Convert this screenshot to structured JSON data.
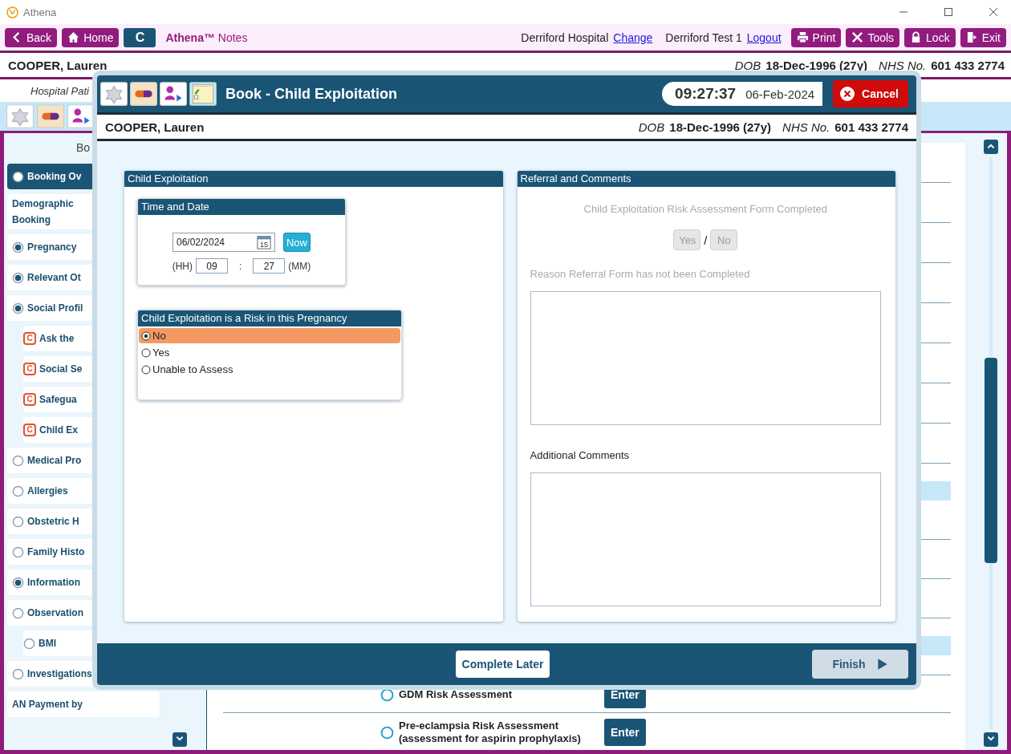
{
  "window": {
    "title": "Athena"
  },
  "toolbar": {
    "nav_buttons": [
      {
        "label": "Back"
      },
      {
        "label": "Home"
      }
    ],
    "c_button": "C",
    "app_name": "**Athena™** Notes",
    "hospital": "Derriford Hospital",
    "hospital_link": "Change",
    "user": "Derriford Test 1",
    "user_link": "Logout",
    "actions": [
      {
        "label": "Print"
      },
      {
        "label": "Tools"
      },
      {
        "label": "Lock"
      },
      {
        "label": "Exit"
      }
    ]
  },
  "patient": {
    "name": "COOPER, Lauren",
    "dob_label": "DOB",
    "dob": "18-Dec-1996 (27y)",
    "nhs_label": "NHS No.",
    "nhs": "601 433 2774"
  },
  "subheader": "Hospital Pati",
  "sidebar": {
    "heading": "Bo",
    "items": [
      {
        "label": "Booking Ov",
        "kind": "radio",
        "checked": false,
        "selected": true
      },
      {
        "label": "Demographic\nBooking",
        "kind": "plain",
        "selected": false
      },
      {
        "label": "Pregnancy",
        "kind": "radio",
        "checked": true,
        "selected": false
      },
      {
        "label": "Relevant Ot",
        "kind": "radio",
        "checked": true,
        "selected": false
      },
      {
        "label": "Social Profil",
        "kind": "radio",
        "checked": true,
        "selected": false,
        "children": [
          {
            "label": "Ask the",
            "kind": "badge",
            "badge": "C",
            "selected": false
          },
          {
            "label": "Social Se",
            "kind": "badge",
            "badge": "C",
            "selected": false
          },
          {
            "label": "Safegua",
            "kind": "badge",
            "badge": "C",
            "selected": false
          },
          {
            "label": "Child Ex",
            "kind": "badge",
            "badge": "C",
            "selected": false
          }
        ]
      },
      {
        "label": "Medical Pro",
        "kind": "radio",
        "checked": false,
        "selected": false
      },
      {
        "label": "Allergies",
        "kind": "radio",
        "checked": false,
        "selected": false
      },
      {
        "label": "Obstetric H",
        "kind": "radio",
        "checked": false,
        "selected": false
      },
      {
        "label": "Family Histo",
        "kind": "radio",
        "checked": false,
        "selected": false
      },
      {
        "label": "Information",
        "kind": "radio",
        "checked": true,
        "selected": false
      },
      {
        "label": "Observation",
        "kind": "radio",
        "checked": false,
        "selected": false,
        "children": [
          {
            "label": "BMI",
            "kind": "radio",
            "checked": false,
            "selected": false
          }
        ]
      },
      {
        "label": "Investigations",
        "kind": "radio",
        "checked": false,
        "selected": false
      },
      {
        "label": "AN Payment by",
        "kind": "plain",
        "selected": false
      }
    ]
  },
  "worklist": [
    {
      "label": "GDM Risk Assessment",
      "action": "Enter",
      "checked": false
    },
    {
      "label": "Pre-eclampsia Risk Assessment (assessment for aspirin prophylaxis)",
      "action": "Enter",
      "checked": false
    }
  ],
  "dialog": {
    "title": "Book - Child Exploitation",
    "time": "09:27:37",
    "date": "06-Feb-2024",
    "cancel": "Cancel",
    "patient": {
      "name": "COOPER, Lauren",
      "dob_label": "DOB",
      "dob": "18-Dec-1996 (27y)",
      "nhs_label": "NHS No.",
      "nhs": "601 433 2774"
    },
    "left_panel": {
      "title": "Child Exploitation",
      "time_date": {
        "title": "Time and Date",
        "date": "06/02/2024",
        "calendar_day": "15",
        "now": "Now",
        "hh_label": "(HH)",
        "hh": "09",
        "separator": ":",
        "mm": "27",
        "mm_label": "(MM)"
      },
      "risk": {
        "title": "Child Exploitation is a Risk in this Pregnancy",
        "options": [
          {
            "label": "No",
            "selected": true
          },
          {
            "label": "Yes",
            "selected": false
          },
          {
            "label": "Unable to Assess",
            "selected": false
          }
        ]
      }
    },
    "right_panel": {
      "title": "Referral and Comments",
      "disabled": true,
      "question": "Child Exploitation Risk Assessment Form Completed",
      "yes": "Yes",
      "slash": "/",
      "no": "No",
      "reason_label": "Reason Referral Form has not been Completed",
      "comments_label": "Additional Comments"
    },
    "footer": {
      "complete_later": "Complete Later",
      "finish": "Finish",
      "finish_disabled": true
    }
  }
}
